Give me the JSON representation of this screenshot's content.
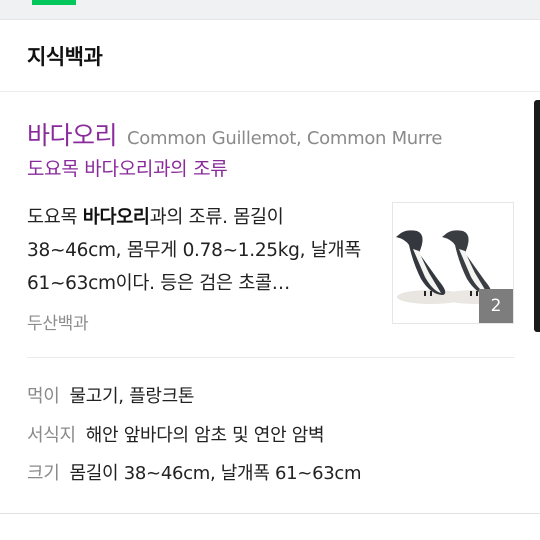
{
  "section": {
    "title": "지식백과"
  },
  "entry": {
    "title": "바다오리",
    "english_name": "Common Guillemot, Common Murre",
    "subtitle": "도요목 바다오리과의 조류",
    "desc_prefix": "도요목 ",
    "desc_bold": "바다오리",
    "desc_rest": "과의 조류. 몸길이 38~46cm, 몸무게 0.78~1.25kg, 날개폭 61~63cm이다. 등은 검은 초콜…",
    "source": "두산백과",
    "image_count": "2"
  },
  "info": [
    {
      "label": "먹이",
      "value": "물고기, 플랑크톤"
    },
    {
      "label": "서식지",
      "value": "해안 앞바다의 암초 및 연안 암벽"
    },
    {
      "label": "크기",
      "value": "몸길이 38~46cm, 날개폭 61~63cm"
    }
  ],
  "colors": {
    "accent_green": "#03c75a",
    "entry_purple": "#8a2b9c"
  }
}
